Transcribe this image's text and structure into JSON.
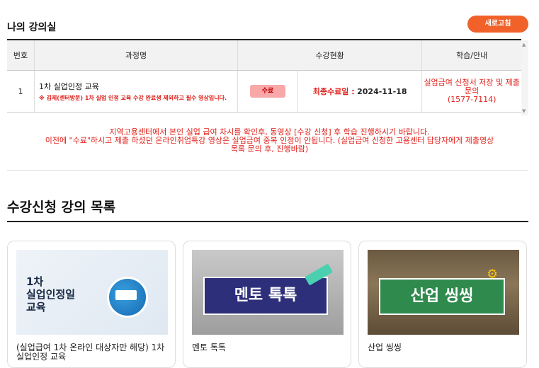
{
  "classroom": {
    "title": "나의 강의실",
    "refresh_label": "새로고침",
    "table": {
      "headers": {
        "num": "번호",
        "course": "과정명",
        "status": "수강현황",
        "guide": "학습/안내"
      },
      "rows": [
        {
          "num": "1",
          "course_name": "1차 실업인정 교육",
          "course_note": "※ 김제(센터방문) 1차 실업 인정 교육 수강 완료생 제외하고 필수 영상입니다.",
          "status_badge": "수료",
          "complete_label": "최종수료일 :",
          "complete_date": "2024-11-18",
          "guide_line1": "실업급여 신청서 저장 및 제출",
          "guide_line2": "문의",
          "guide_line3": "(1577-7114)"
        }
      ]
    },
    "notice_line1": "지역고용센터에서 본인 실업 급여 차시를 확인후, 동영상 [수강 신청] 후 학습 진행하시기 바랍니다.",
    "notice_line2": "이전에 \"수료\"하시고 제출 하셨던 온라인취업특강 영상은 실업급여 중복 인정이 안됩니다. (실업급여 신청한 고용센터 담당자에게 제출영상",
    "notice_line3": "목록 문의 후, 진행바람)"
  },
  "course_list": {
    "title": "수강신청 강의 목록",
    "cards": [
      {
        "title": "(실업급여 1차 온라인 대상자만 해당) 1차 실업인정 교육",
        "thumb_lines": [
          "1차",
          "실업인정일",
          "교육"
        ]
      },
      {
        "title": "멘토 톡톡",
        "thumb_text": "멘토 톡톡"
      },
      {
        "title": "산업 씽씽",
        "thumb_text": "산업 씽씽"
      }
    ]
  },
  "colors": {
    "accent": "#f0622a",
    "alert_red": "#e0201a",
    "badge_pink": "#f8a8a8"
  }
}
